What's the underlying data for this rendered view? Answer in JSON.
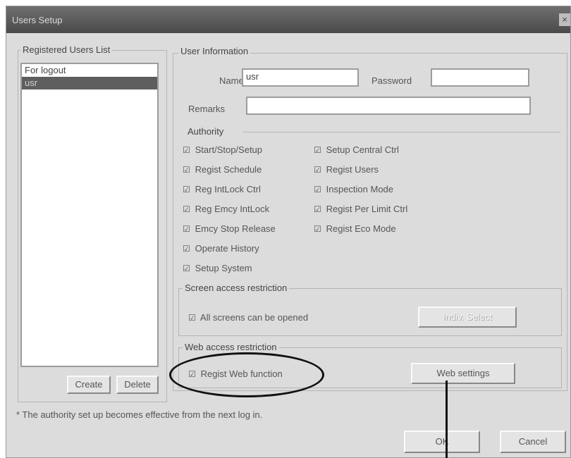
{
  "window": {
    "title": "Users Setup",
    "close_glyph": "×"
  },
  "users_list": {
    "label": "Registered Users List",
    "items": [
      {
        "label": "For logout",
        "selected": false
      },
      {
        "label": "usr",
        "selected": true
      }
    ],
    "create_label": "Create",
    "delete_label": "Delete"
  },
  "user_info": {
    "label": "User Information",
    "name_label": "Name",
    "name_value": "usr",
    "password_label": "Password",
    "password_value": "",
    "remarks_label": "Remarks",
    "remarks_value": ""
  },
  "authority": {
    "label": "Authority",
    "checked_glyph": "☑",
    "items": [
      {
        "label": "Start/Stop/Setup",
        "checked": true
      },
      {
        "label": "Regist Schedule",
        "checked": true
      },
      {
        "label": "Reg IntLock Ctrl",
        "checked": true
      },
      {
        "label": "Reg Emcy IntLock",
        "checked": true
      },
      {
        "label": "Emcy Stop Release",
        "checked": true
      },
      {
        "label": "Operate History",
        "checked": true
      },
      {
        "label": "Setup System",
        "checked": true
      },
      {
        "label": "Setup Central Ctrl",
        "checked": true
      },
      {
        "label": "Regist Users",
        "checked": true
      },
      {
        "label": "Inspection Mode",
        "checked": true
      },
      {
        "label": "Regist Per Limit Ctrl",
        "checked": true
      },
      {
        "label": "Regist Eco Mode",
        "checked": true
      }
    ]
  },
  "screen_access": {
    "label": "Screen access restriction",
    "checkbox_label": "All screens can be opened",
    "button_label": "Indiv. Select"
  },
  "web_access": {
    "label": "Web access restriction",
    "checkbox_label": "Regist Web function",
    "button_label": "Web settings"
  },
  "footer": {
    "note": "* The authority set up becomes effective from the next log in.",
    "ok_label": "OK",
    "cancel_label": "Cancel"
  }
}
